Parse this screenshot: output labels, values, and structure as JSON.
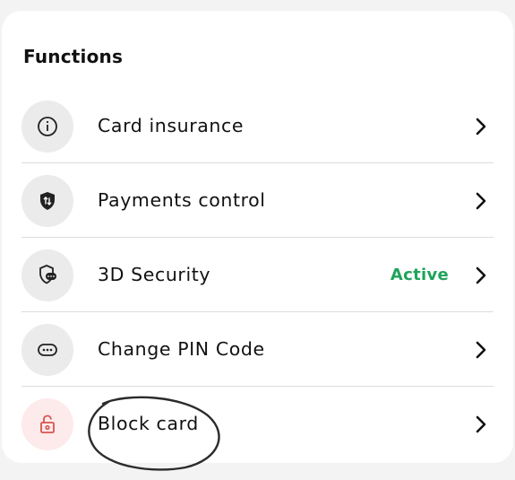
{
  "section": {
    "title": "Functions"
  },
  "rows": [
    {
      "label": "Card insurance",
      "icon": "info-icon"
    },
    {
      "label": "Payments control",
      "icon": "shield-payments-icon"
    },
    {
      "label": "3D Security",
      "icon": "shield-chat-icon",
      "status": "Active",
      "status_color": "#1fa35a"
    },
    {
      "label": "Change PIN Code",
      "icon": "pin-dots-icon"
    },
    {
      "label": "Block card",
      "icon": "unlock-icon",
      "icon_color": "#d9534f"
    }
  ]
}
